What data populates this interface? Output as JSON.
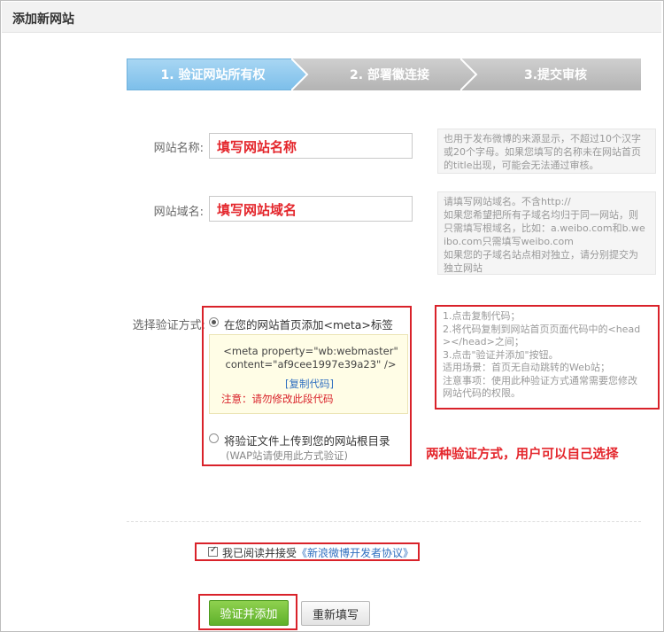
{
  "header": {
    "title": "添加新网站"
  },
  "steps": [
    {
      "label": "1. 验证网站所有权"
    },
    {
      "label": "2. 部署徽连接"
    },
    {
      "label": "3.提交审核"
    }
  ],
  "site_name": {
    "label": "网站名称:",
    "value": "填写网站名称",
    "help": "也用于发布微博的来源显示，不超过10个汉字或20个字母。如果您填写的名称未在网站首页的title出现，可能会无法通过审核。"
  },
  "site_domain": {
    "label": "网站域名:",
    "value": "填写网站域名",
    "help_lines": [
      "请填写网站域名。不含http://",
      "如果您希望把所有子域名均归于同一网站，则",
      "只需填写根域名，比如：a.weibo.com和b.we",
      "ibo.com只需填写weibo.com",
      "如果您的子域名站点相对独立，请分别提交为",
      "独立网站"
    ]
  },
  "verify": {
    "label": "选择验证方式:",
    "option_meta": "在您的网站首页添加<meta>标签",
    "meta_code": "<meta property=\"wb:webmaster\" content=\"af9cee1997e39a23\" />",
    "copy_link": "[复制代码]",
    "warning": "注意：请勿修改此段代码",
    "option_file": "将验证文件上传到您的网站根目录",
    "option_file_note": "(WAP站请使用此方式验证)",
    "info_lines": [
      "1.点击复制代码；",
      "2.将代码复制到网站首页页面代码中的<head",
      "></head>之间；",
      "3.点击\"验证并添加\"按钮。",
      "适用场景：首页无自动跳转的Web站；",
      "注意事项：使用此种验证方式通常需要您修改",
      "网站代码的权限。"
    ],
    "annotation": "两种验证方式，用户可以自己选择"
  },
  "agreement": {
    "text": "我已阅读并接受",
    "link": "《新浪微博开发者协议》",
    "checked": true
  },
  "buttons": {
    "submit": "验证并添加",
    "reset": "重新填写"
  },
  "colors": {
    "accent_red": "#e4262c",
    "step_active": "#7dbfea",
    "submit_green": "#5fb12b",
    "link_blue": "#2f6fc0"
  }
}
